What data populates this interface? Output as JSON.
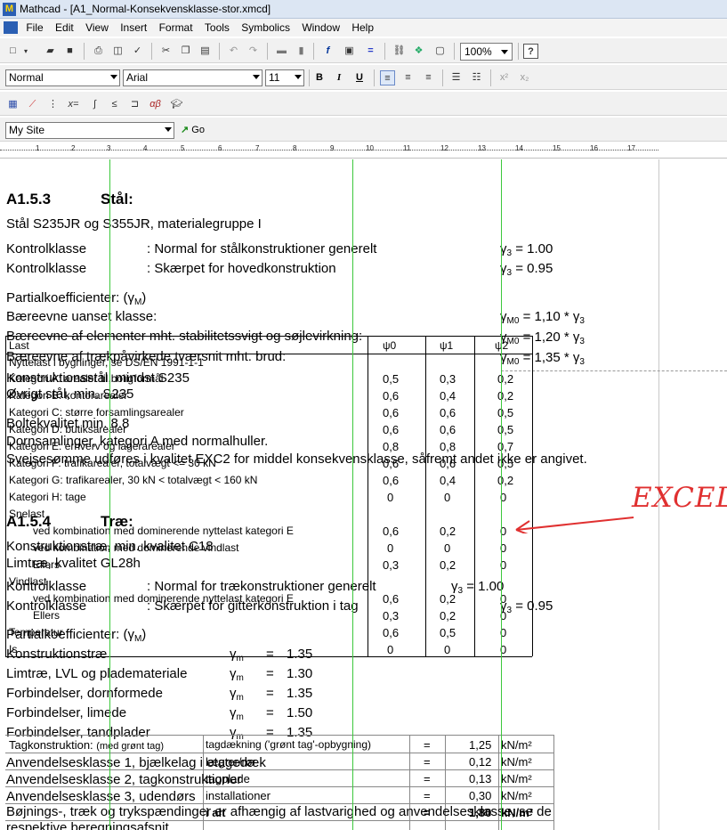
{
  "window": {
    "title": "Mathcad - [A1_Normal-Konsekvensklasse-stor.xmcd]"
  },
  "menu": [
    "File",
    "Edit",
    "View",
    "Insert",
    "Format",
    "Tools",
    "Symbolics",
    "Window",
    "Help"
  ],
  "toolbar": {
    "zoom": "100%",
    "style": "Normal",
    "font": "Arial",
    "size": "11",
    "bold": "B",
    "italic": "I",
    "underline": "U",
    "site": "My Site",
    "go": "Go"
  },
  "ruler": [
    "1",
    "2",
    "3",
    "4",
    "5",
    "6",
    "7",
    "8",
    "9",
    "10",
    "11",
    "12",
    "13",
    "14",
    "15",
    "16",
    "17"
  ],
  "s153": {
    "heading": "A1.5.3",
    "heading_title": "Stål:",
    "intro": "Stål S235JR og S355JR, materialegruppe I",
    "k1_label": "Kontrolklasse",
    "k1_text": ": Normal for stålkonstruktioner generelt",
    "k1_gamma": "γ",
    "k1_sub": "3",
    "k1_val": " = 1.00",
    "k2_label": "Kontrolklasse",
    "k2_text": ": Skærpet for hovedkonstruktion",
    "k2_gamma": "γ",
    "k2_sub": "3",
    "k2_val": " = 0.95",
    "pk_label": "Partialkoefficienter: (γ",
    "pk_sub": "M",
    "pk_close": ")",
    "r1": "Bæreevne uanset klasse:",
    "r1_g": "γ",
    "r1_sub": "M0",
    "r1_val": " = 1,10 * γ",
    "r1_s2": "3",
    "r2": "Bæreevne af elementer mht. stabilitetssvigt og søjlevirkning:",
    "r2_g": "γ",
    "r2_sub": "M0",
    "r2_val": " = 1,20 * γ",
    "r2_s2": "3",
    "r3": "Bæreevne af trækpåvirkede tværsnit mht. brud:",
    "r3_g": "γ",
    "r3_sub": "M0",
    "r3_val": " = 1,35 * γ",
    "r3_s2": "3",
    "m1": "Konstruktionsstål, mindst S235",
    "m2": "Øvrigt stål, min. S235",
    "m3": "Boltekvalitet min. 8.8",
    "m4": "Dornsamlinger, kategori A med normalhuller.",
    "weld": "Svejsesømme udføres i kvalitet EXC2 for middel konsekvensklasse, såfremt andet ikke er angivet."
  },
  "psi_table": {
    "headers": [
      "Last",
      "ψ0",
      "ψ1",
      "ψ2"
    ],
    "rows": [
      {
        "label": "Nyttelast i bygninger, se DS/EN 1991-1-1",
        "v0": "",
        "v1": "",
        "v2": ""
      },
      {
        "label": "Kategori A: arealer til boligformål",
        "v0": "0,5",
        "v1": "0,3",
        "v2": "0,2"
      },
      {
        "label": "Kategori B: kontorarealer",
        "v0": "0,6",
        "v1": "0,4",
        "v2": "0,2"
      },
      {
        "label": "Kategori C: større forsamlingsarealer",
        "v0": "0,6",
        "v1": "0,6",
        "v2": "0,5"
      },
      {
        "label": "Kategori D: butiksarealer",
        "v0": "0,6",
        "v1": "0,6",
        "v2": "0,5"
      },
      {
        "label": "Kategori E: erhverv og lagerarealer",
        "v0": "0,8",
        "v1": "0,8",
        "v2": "0,7"
      },
      {
        "label": "Kategori F: trafikarealer, totalvægt <= 30 kN",
        "v0": "0,6",
        "v1": "0,6",
        "v2": "0,5"
      },
      {
        "label": "Kategori G: trafikarealer, 30 kN < totalvægt < 160 kN",
        "v0": "0,6",
        "v1": "0,4",
        "v2": "0,2"
      },
      {
        "label": "Kategori H: tage",
        "v0": "0",
        "v1": "0",
        "v2": "0"
      },
      {
        "label": "Snelast",
        "v0": "",
        "v1": "",
        "v2": ""
      },
      {
        "label": "ved kombination med dominerende nyttelast kategori E",
        "v0": "0,6",
        "v1": "0,2",
        "v2": "0"
      },
      {
        "label": "ved kombination med dominerende vindlast",
        "v0": "0",
        "v1": "0",
        "v2": "0"
      },
      {
        "label": "Ellers",
        "v0": "0,3",
        "v1": "0,2",
        "v2": "0"
      },
      {
        "label": "Vindlast",
        "v0": "",
        "v1": "",
        "v2": ""
      },
      {
        "label": "ved kombination med dominerende nyttelast kategori E",
        "v0": "0,6",
        "v1": "0,2",
        "v2": "0"
      },
      {
        "label": "Ellers",
        "v0": "0,3",
        "v1": "0,2",
        "v2": "0"
      },
      {
        "label": "Temperatur",
        "v0": "0,6",
        "v1": "0,5",
        "v2": "0"
      },
      {
        "label": "Is",
        "v0": "0",
        "v1": "0",
        "v2": "0"
      }
    ]
  },
  "excel_annotation": "EXCEL",
  "s154": {
    "heading": "A1.5.4",
    "heading_title": "Træ:",
    "l1": "Konstruktionstræ, min. kvalitet C18",
    "l2": "Limtræ, kvalitet GL28h",
    "k1_label": "Kontrolklasse",
    "k1_text": ": Normal for trækonstruktioner generelt",
    "k1_g": "γ",
    "k1_sub": "3",
    "k1_val": " = 1.00",
    "k2_label": "Kontrolklasse",
    "k2_text": ": Skærpet for gitterkonstruktion i tag",
    "k2_g": "γ",
    "k2_sub": "3",
    "k2_val": " = 0.95",
    "pk_label": "Partialkoefficienter: (γ",
    "pk_sub": "M",
    "pk_close": ")",
    "gm": [
      {
        "label": "Konstruktionstræ",
        "g": "γ",
        "sub": "m",
        "eq": "=",
        "val": "1.35"
      },
      {
        "label": "Limtræ, LVL og plademateriale",
        "g": "γ",
        "sub": "m",
        "eq": "=",
        "val": "1.30"
      },
      {
        "label": "Forbindelser, dornformede",
        "g": "γ",
        "sub": "m",
        "eq": "=",
        "val": "1.35"
      },
      {
        "label": "Forbindelser, limede",
        "g": "γ",
        "sub": "m",
        "eq": "=",
        "val": "1.50"
      },
      {
        "label": "Forbindelser, tandplader",
        "g": "γ",
        "sub": "m",
        "eq": "=",
        "val": "1.35"
      }
    ],
    "a1": "Anvendelsesklasse 1, bjælkelag i etagedæk",
    "a2": "Anvendelsesklasse 2, tagkonstruktioner",
    "a3": "Anvendelsesklasse 3, udendørs",
    "b1": "Bøjnings-, træk og trykspændinger er afhængig af lastvarighed og anvendelsesklasse, se de",
    "b2": "respektive beregningsafsnit"
  },
  "roof_table": {
    "title_a": "Tagkonstruktion: ",
    "title_b": "(med grønt tag)",
    "rows": [
      {
        "item": "tagdækning ('grønt tag'-opbygning)",
        "eq": "=",
        "val": "1,25",
        "unit": "kN/m²"
      },
      {
        "item": "lægter/rør",
        "eq": "=",
        "val": "0,12",
        "unit": "kN/m²"
      },
      {
        "item": "tagplade",
        "eq": "=",
        "val": "0,13",
        "unit": "kN/m²"
      },
      {
        "item": "installationer",
        "eq": "=",
        "val": "0,30",
        "unit": "kN/m²"
      }
    ],
    "total_label": "i alt",
    "total_eq": "=",
    "total_val": "1,80",
    "total_unit": "kN/m²"
  }
}
